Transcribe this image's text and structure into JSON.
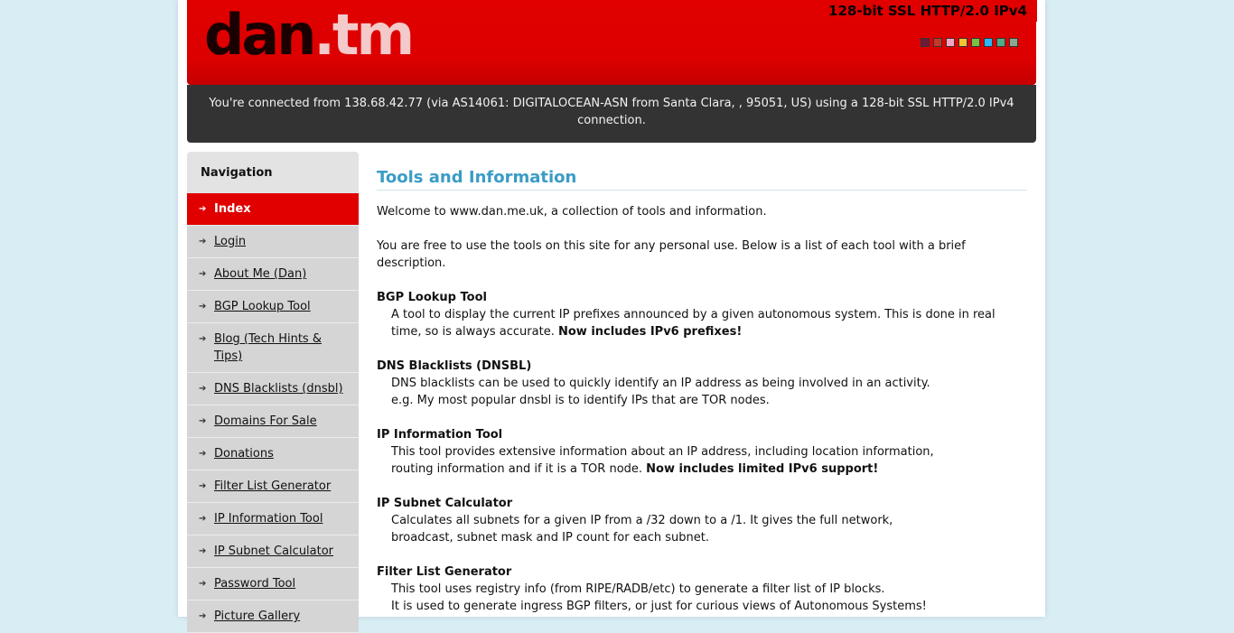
{
  "ssl_badge": "128-bit SSL HTTP/2.0 IPv4",
  "logo": {
    "part1": "dan",
    "part2": ".tm"
  },
  "swatch_colors": [
    "#6b1a3a",
    "#c0392b",
    "#f4a6c0",
    "#f4c430",
    "#7ac143",
    "#29b6f6",
    "#4caf8a",
    "#8fa68e"
  ],
  "connection_text": "You're connected from 138.68.42.77 (via AS14061: DIGITALOCEAN-ASN from Santa Clara, , 95051, US) using a 128-bit SSL HTTP/2.0 IPv4 connection.",
  "nav": {
    "title": "Navigation",
    "items": [
      {
        "label": "Index",
        "active": true
      },
      {
        "label": "Login"
      },
      {
        "label": "About Me (Dan)"
      },
      {
        "label": "BGP Lookup Tool"
      },
      {
        "label": "Blog (Tech Hints & Tips)"
      },
      {
        "label": "DNS Blacklists (dnsbl)"
      },
      {
        "label": "Domains For Sale"
      },
      {
        "label": "Donations"
      },
      {
        "label": "Filter List Generator"
      },
      {
        "label": "IP Information Tool"
      },
      {
        "label": "IP Subnet Calculator"
      },
      {
        "label": "Password Tool"
      },
      {
        "label": "Picture Gallery"
      }
    ]
  },
  "content": {
    "title": "Tools and Information",
    "intro1": "Welcome to www.dan.me.uk, a collection of tools and information.",
    "intro2": "You are free to use the tools on this site for any personal use. Below is a list of each tool with a brief description.",
    "tools": [
      {
        "name": "BGP Lookup Tool",
        "desc": "A tool to display the current IP prefixes announced by a given autonomous system. This is done in real time, so is always accurate.",
        "bold": "Now includes IPv6 prefixes!"
      },
      {
        "name": "DNS Blacklists (DNSBL)",
        "desc": "DNS blacklists can be used to quickly identify an IP address as being involved in an activity.",
        "desc2": "e.g. My most popular dnsbl is to identify IPs that are TOR nodes."
      },
      {
        "name": "IP Information Tool",
        "desc": "This tool provides extensive information about an IP address, including location information,",
        "desc2": "routing information and if it is a TOR node.",
        "bold": "Now includes limited IPv6 support!"
      },
      {
        "name": "IP Subnet Calculator",
        "desc": "Calculates all subnets for a given IP from a /32 down to a /1. It gives the full network,",
        "desc2": "broadcast, subnet mask and IP count for each subnet."
      },
      {
        "name": "Filter List Generator",
        "desc": "This tool uses registry info (from RIPE/RADB/etc) to generate a filter list of IP blocks.",
        "desc2": "It is used to generate ingress BGP filters, or just for curious views of Autonomous Systems!"
      }
    ]
  }
}
